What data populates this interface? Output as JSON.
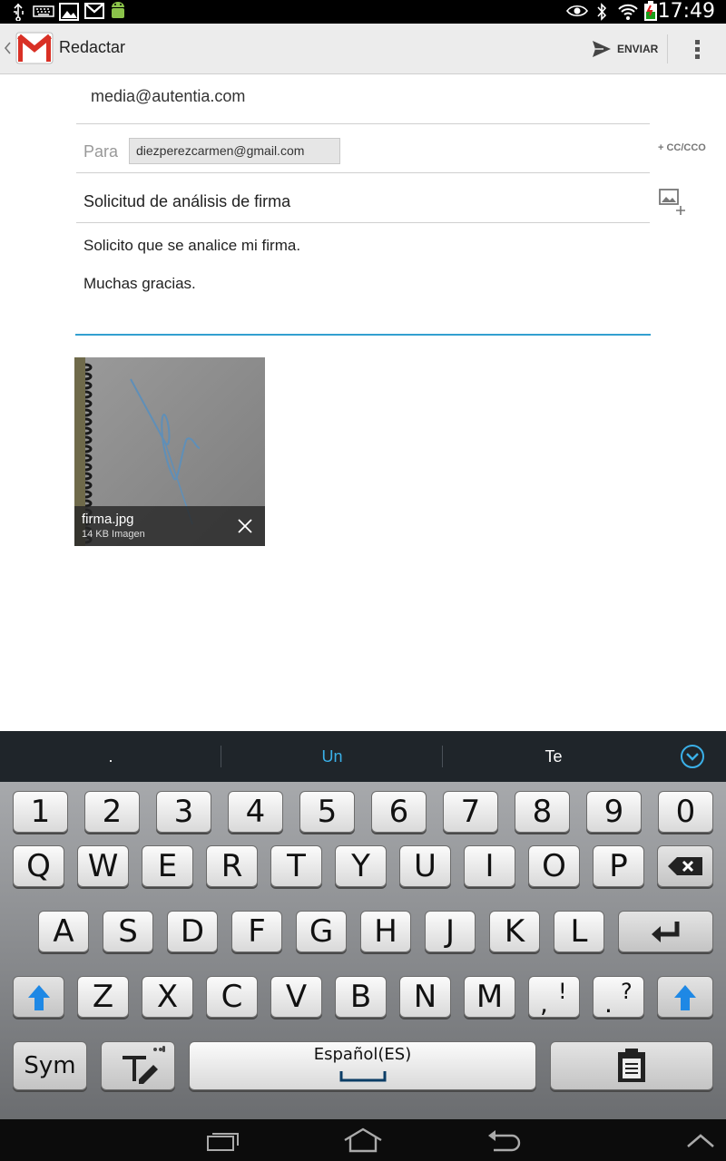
{
  "status_bar": {
    "time": "17:49"
  },
  "action_bar": {
    "title": "Redactar",
    "send_label": "ENVIAR"
  },
  "compose": {
    "from": "media@autentia.com",
    "to_label": "Para",
    "to_recipient": "diezperezcarmen@gmail.com",
    "cc_label": "+ CC/CCO",
    "subject": "Solicitud de análisis de firma",
    "body_line1": "Solicito que se analice mi firma.",
    "body_line2": "Muchas gracias."
  },
  "attachment": {
    "filename": "firma.jpg",
    "meta": "14 KB Imagen"
  },
  "suggestions": [
    ".",
    "Un",
    "Te"
  ],
  "keyboard": {
    "row_numbers": [
      "1",
      "2",
      "3",
      "4",
      "5",
      "6",
      "7",
      "8",
      "9",
      "0"
    ],
    "row1": [
      "Q",
      "W",
      "E",
      "R",
      "T",
      "Y",
      "U",
      "I",
      "O",
      "P"
    ],
    "row2": [
      "A",
      "S",
      "D",
      "F",
      "G",
      "H",
      "J",
      "K",
      "L"
    ],
    "row3": [
      "Z",
      "X",
      "C",
      "V",
      "B",
      "N",
      "M"
    ],
    "punct1_top": "!",
    "punct1_bottom": ",",
    "punct2_top": "?",
    "punct2_bottom": ".",
    "sym_label": "Sym",
    "space_label": "Español(ES)"
  },
  "colors": {
    "accent": "#33a0d0",
    "suggestion_highlight": "#3ab0e8",
    "shift_blue": "#1e88e5"
  }
}
